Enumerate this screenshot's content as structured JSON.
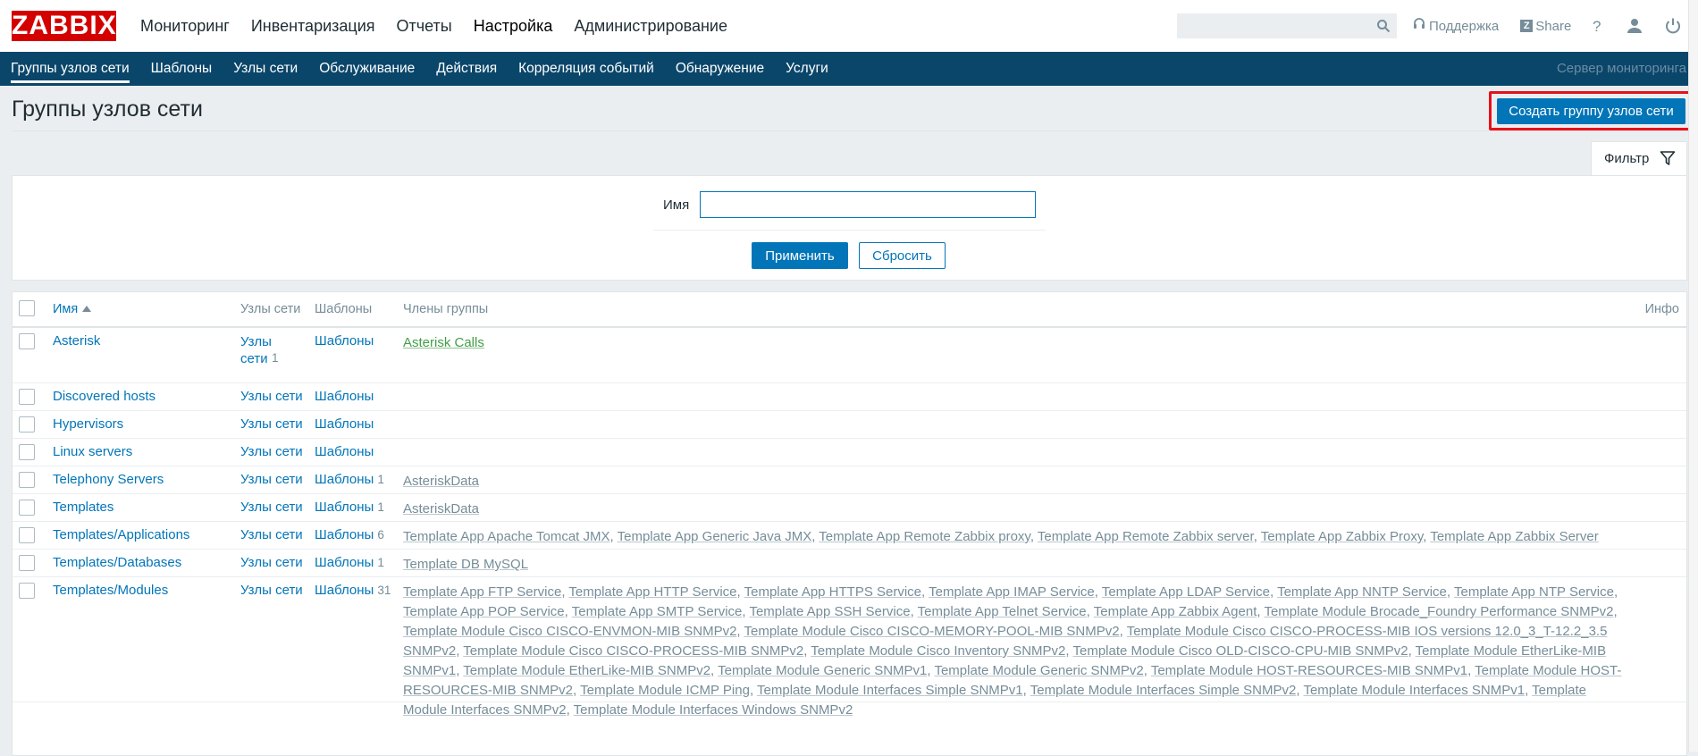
{
  "logo": "ZABBIX",
  "mainnav": [
    "Мониторинг",
    "Инвентаризация",
    "Отчеты",
    "Настройка",
    "Администрирование"
  ],
  "mainnav_active": "Настройка",
  "search": {
    "value": ""
  },
  "toplinks": {
    "support": "Поддержка",
    "share": "Share"
  },
  "subnav": [
    "Группы узлов сети",
    "Шаблоны",
    "Узлы сети",
    "Обслуживание",
    "Действия",
    "Корреляция событий",
    "Обнаружение",
    "Услуги"
  ],
  "subnav_active": "Группы узлов сети",
  "server_label": "Сервер мониторинга",
  "page": {
    "title": "Группы узлов сети",
    "create_button": "Создать группу узлов сети"
  },
  "filter": {
    "tab_label": "Фильтр",
    "name_label": "Имя",
    "name_value": "",
    "apply": "Применить",
    "reset": "Сбросить"
  },
  "table": {
    "headers": {
      "name": "Имя",
      "hosts": "Узлы сети",
      "templates": "Шаблоны",
      "members": "Члены группы",
      "info": "Инфо"
    },
    "rows": [
      {
        "name": "Asterisk",
        "hosts_label": "Узлы сети",
        "hosts_count": "1",
        "templates_label": "Шаблоны",
        "templates_count": "",
        "members": [
          "Asterisk Calls"
        ],
        "member_color": "green"
      },
      {
        "name": "Discovered hosts",
        "hosts_label": "Узлы сети",
        "hosts_count": "",
        "templates_label": "Шаблоны",
        "templates_count": "",
        "members": []
      },
      {
        "name": "Hypervisors",
        "hosts_label": "Узлы сети",
        "hosts_count": "",
        "templates_label": "Шаблоны",
        "templates_count": "",
        "members": []
      },
      {
        "name": "Linux servers",
        "hosts_label": "Узлы сети",
        "hosts_count": "",
        "templates_label": "Шаблоны",
        "templates_count": "",
        "members": []
      },
      {
        "name": "Telephony Servers",
        "hosts_label": "Узлы сети",
        "hosts_count": "",
        "templates_label": "Шаблоны",
        "templates_count": "1",
        "members": [
          "AsteriskData"
        ]
      },
      {
        "name": "Templates",
        "hosts_label": "Узлы сети",
        "hosts_count": "",
        "templates_label": "Шаблоны",
        "templates_count": "1",
        "members": [
          "AsteriskData"
        ]
      },
      {
        "name": "Templates/Applications",
        "hosts_label": "Узлы сети",
        "hosts_count": "",
        "templates_label": "Шаблоны",
        "templates_count": "6",
        "members": [
          "Template App Apache Tomcat JMX",
          "Template App Generic Java JMX",
          "Template App Remote Zabbix proxy",
          "Template App Remote Zabbix server",
          "Template App Zabbix Proxy",
          "Template App Zabbix Server"
        ]
      },
      {
        "name": "Templates/Databases",
        "hosts_label": "Узлы сети",
        "hosts_count": "",
        "templates_label": "Шаблоны",
        "templates_count": "1",
        "members": [
          "Template DB MySQL"
        ]
      },
      {
        "name": "Templates/Modules",
        "hosts_label": "Узлы сети",
        "hosts_count": "",
        "templates_label": "Шаблоны",
        "templates_count": "31",
        "members": [
          "Template App FTP Service",
          "Template App HTTP Service",
          "Template App HTTPS Service",
          "Template App IMAP Service",
          "Template App LDAP Service",
          "Template App NNTP Service",
          "Template App NTP Service",
          "Template App POP Service",
          "Template App SMTP Service",
          "Template App SSH Service",
          "Template App Telnet Service",
          "Template App Zabbix Agent",
          "Template Module Brocade_Foundry Performance SNMPv2",
          "Template Module Cisco CISCO-ENVMON-MIB SNMPv2",
          "Template Module Cisco CISCO-MEMORY-POOL-MIB SNMPv2",
          "Template Module Cisco CISCO-PROCESS-MIB IOS versions 12.0_3_T-12.2_3.5 SNMPv2",
          "Template Module Cisco CISCO-PROCESS-MIB SNMPv2",
          "Template Module Cisco Inventory SNMPv2",
          "Template Module Cisco OLD-CISCO-CPU-MIB SNMPv2",
          "Template Module EtherLike-MIB SNMPv1",
          "Template Module EtherLike-MIB SNMPv2",
          "Template Module Generic SNMPv1",
          "Template Module Generic SNMPv2",
          "Template Module HOST-RESOURCES-MIB SNMPv1",
          "Template Module HOST-RESOURCES-MIB SNMPv2",
          "Template Module ICMP Ping",
          "Template Module Interfaces Simple SNMPv1",
          "Template Module Interfaces Simple SNMPv2",
          "Template Module Interfaces SNMPv1",
          "Template Module Interfaces SNMPv2",
          "Template Module Interfaces Windows SNMPv2"
        ]
      }
    ]
  }
}
